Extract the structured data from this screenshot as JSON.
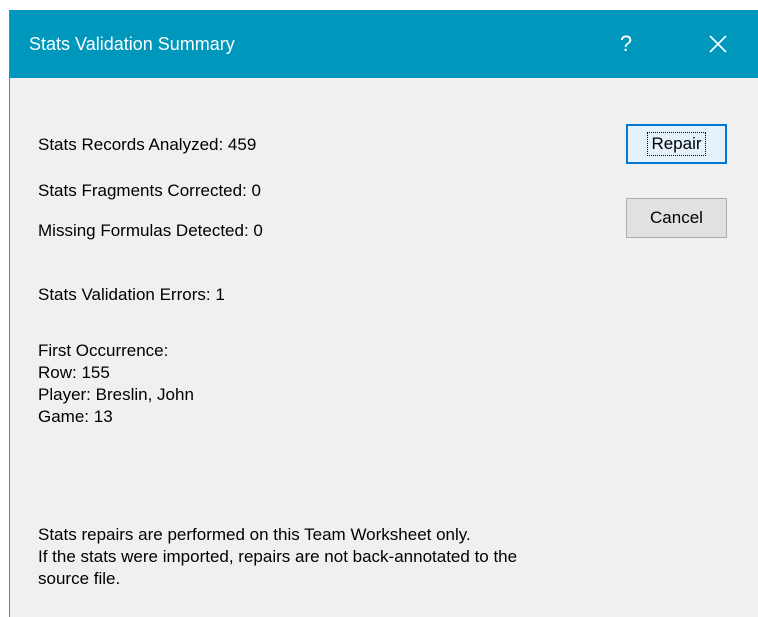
{
  "dialog": {
    "title": "Stats Validation Summary",
    "help_label": "?",
    "close_icon": "close-icon"
  },
  "summary": {
    "records_analyzed": "Stats Records Analyzed: 459",
    "fragments_corrected": "Stats Fragments Corrected: 0",
    "missing_formulas": "Missing Formulas Detected: 0",
    "validation_errors": "Stats Validation Errors: 1"
  },
  "occurrence": {
    "heading": "First Occurrence:",
    "row": "Row: 155",
    "player": "Player: Breslin, John",
    "game": "Game: 13"
  },
  "note": {
    "line1": "Stats repairs are performed on this Team Worksheet only.",
    "line2": "If the stats were imported, repairs are not back-annotated to the",
    "line3": "source file."
  },
  "buttons": {
    "repair_label": "Repair",
    "cancel_label": "Cancel"
  },
  "colors": {
    "titlebar": "#0097bd",
    "dialog_background": "#f0f0f0",
    "default_button_border": "#0078d7"
  }
}
